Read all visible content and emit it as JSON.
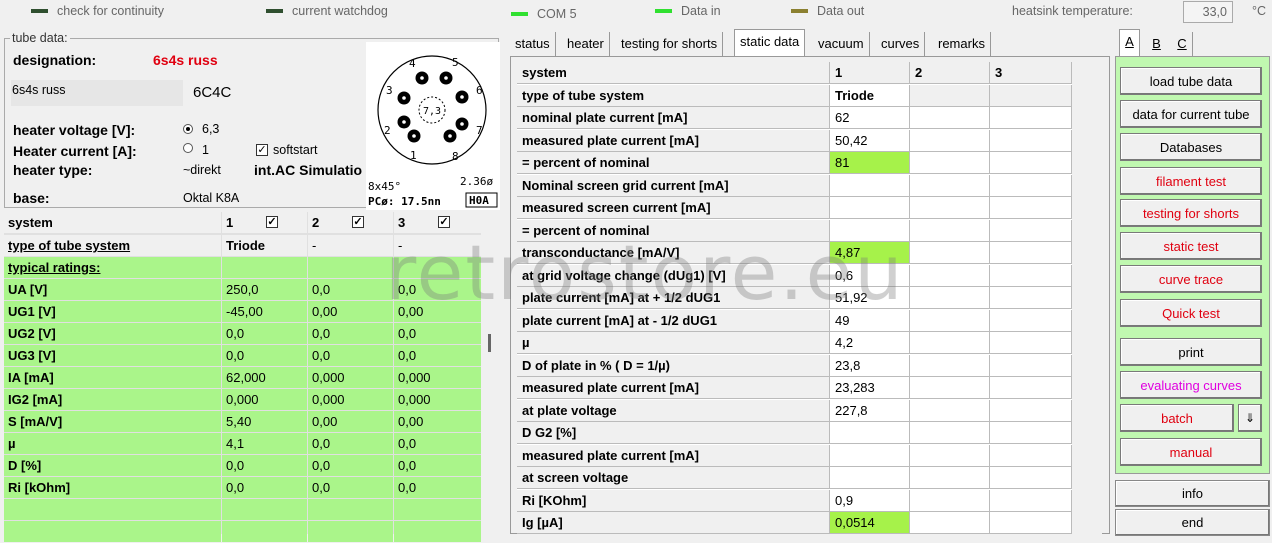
{
  "status_bar": {
    "indicators": [
      {
        "label": "check for continuity",
        "color": "#2f4f2f"
      },
      {
        "label": "current watchdog",
        "color": "#2f4f2f"
      },
      {
        "label": "COM 5",
        "color": "#30e030"
      },
      {
        "label": "Data in",
        "color": "#30e030"
      },
      {
        "label": "Data out",
        "color": "#8b8030"
      }
    ],
    "heatsink_label": "heatsink temperature:",
    "heatsink_value": "33,0",
    "heatsink_unit": "°C"
  },
  "tube_data": {
    "group_title": "tube data:",
    "designation_label": "designation:",
    "designation_value": "6s4s russ",
    "name_field": "6s4s russ",
    "alt_name": "6C4C",
    "heater_voltage_label": "heater voltage [V]:",
    "heater_voltage_value": "6,3",
    "heater_current_label": "Heater current [A]:",
    "heater_current_value": "1",
    "softstart_label": "softstart",
    "heater_type_label": "heater type:",
    "heater_type_value": "~direkt",
    "ac_sim_label": "int.AC Simulatio",
    "base_label": "base:",
    "base_value": "Oktal K8A",
    "diagram": {
      "pins": [
        "1",
        "2",
        "3",
        "4",
        "5",
        "6",
        "7",
        "8"
      ],
      "center": "7,3",
      "dims": "8x45°",
      "dia": "2.36ø",
      "pc": "PCø: 17.5nn",
      "code": "H0A"
    }
  },
  "left_grid": {
    "headers": [
      "system",
      "1",
      "2",
      "3"
    ],
    "rows": [
      {
        "label": "type of tube system",
        "v1": "Triode",
        "v2": "-",
        "v3": "-"
      },
      {
        "label": "typical ratings:",
        "v1": "",
        "v2": "",
        "v3": ""
      },
      {
        "label": "UA [V]",
        "v1": "250,0",
        "v2": "0,0",
        "v3": "0,0"
      },
      {
        "label": "UG1 [V]",
        "v1": "-45,00",
        "v2": "0,00",
        "v3": "0,00"
      },
      {
        "label": "UG2 [V]",
        "v1": "0,0",
        "v2": "0,0",
        "v3": "0,0"
      },
      {
        "label": "UG3 [V]",
        "v1": "0,0",
        "v2": "0,0",
        "v3": "0,0"
      },
      {
        "label": "IA [mA]",
        "v1": "62,000",
        "v2": "0,000",
        "v3": "0,000"
      },
      {
        "label": "IG2 [mA]",
        "v1": "0,000",
        "v2": "0,000",
        "v3": "0,000"
      },
      {
        "label": "S [mA/V]",
        "v1": "5,40",
        "v2": "0,00",
        "v3": "0,00"
      },
      {
        "label": "µ",
        "v1": "4,1",
        "v2": "0,0",
        "v3": "0,0"
      },
      {
        "label": "D [%]",
        "v1": "0,0",
        "v2": "0,0",
        "v3": "0,0"
      },
      {
        "label": "Ri [kOhm]",
        "v1": "0,0",
        "v2": "0,0",
        "v3": "0,0"
      },
      {
        "label": "",
        "v1": "",
        "v2": "",
        "v3": ""
      },
      {
        "label": "",
        "v1": "",
        "v2": "",
        "v3": ""
      }
    ]
  },
  "tabs": [
    "status",
    "heater",
    "testing for shorts",
    "static data",
    "vacuum",
    "curves",
    "remarks"
  ],
  "active_tab": "static data",
  "right_grid": {
    "headers": [
      "system",
      "1",
      "2",
      "3"
    ],
    "rows": [
      {
        "label": "type of tube system",
        "v1": "Triode",
        "hl": false
      },
      {
        "label": "nominal plate current [mA]",
        "v1": "62",
        "hl": false
      },
      {
        "label": "measured plate current [mA]",
        "v1": "50,42",
        "hl": false
      },
      {
        "label": "= percent of nominal",
        "v1": "81",
        "hl": true
      },
      {
        "label": "Nominal screen grid current [mA]",
        "v1": "",
        "hl": false
      },
      {
        "label": "measured screen current [mA]",
        "v1": "",
        "hl": false
      },
      {
        "label": "= percent of nominal",
        "v1": "",
        "hl": false
      },
      {
        "label": "transconductance [mA/V]",
        "v1": "4,87",
        "hl": true
      },
      {
        "label": "at grid voltage change (dUg1) [V]",
        "v1": "0,6",
        "hl": false
      },
      {
        "label": "plate current [mA] at + 1/2 dUG1",
        "v1": "51,92",
        "hl": false
      },
      {
        "label": "plate current [mA] at - 1/2 dUG1",
        "v1": "49",
        "hl": false
      },
      {
        "label": "µ",
        "v1": "4,2",
        "hl": false
      },
      {
        "label": "D of plate in % ( D = 1/µ)",
        "v1": "23,8",
        "hl": false
      },
      {
        "label": "measured plate current [mA]",
        "v1": "23,283",
        "hl": false
      },
      {
        "label": "at plate voltage",
        "v1": "227,8",
        "hl": false
      },
      {
        "label": "D G2 [%]",
        "v1": "",
        "hl": false
      },
      {
        "label": "measured plate current [mA]",
        "v1": "",
        "hl": false
      },
      {
        "label": "at screen voltage",
        "v1": "",
        "hl": false
      },
      {
        "label": "Ri [KOhm]",
        "v1": "0,9",
        "hl": false
      },
      {
        "label": "Ig [µA]",
        "v1": "0,0514",
        "hl": true
      }
    ]
  },
  "side_tabs": [
    "A",
    "B",
    "C"
  ],
  "buttons": {
    "load": "load tube data",
    "current": "data for current tube",
    "databases": "Databases",
    "filament": "filament test",
    "shorts": "testing for shorts",
    "static": "static test",
    "curve": "curve trace",
    "quick": "Quick test",
    "print": "print",
    "evaluating": "evaluating curves",
    "batch": "batch",
    "batch_arrow": "⇓",
    "manual": "manual",
    "info": "info",
    "end": "end"
  },
  "watermark": "retrostore.eu",
  "colors": {
    "green_cell": "#aaf58a",
    "highlight": "#a6f24a",
    "panel_green": "#c0f8b0",
    "red_text": "#e00010"
  }
}
